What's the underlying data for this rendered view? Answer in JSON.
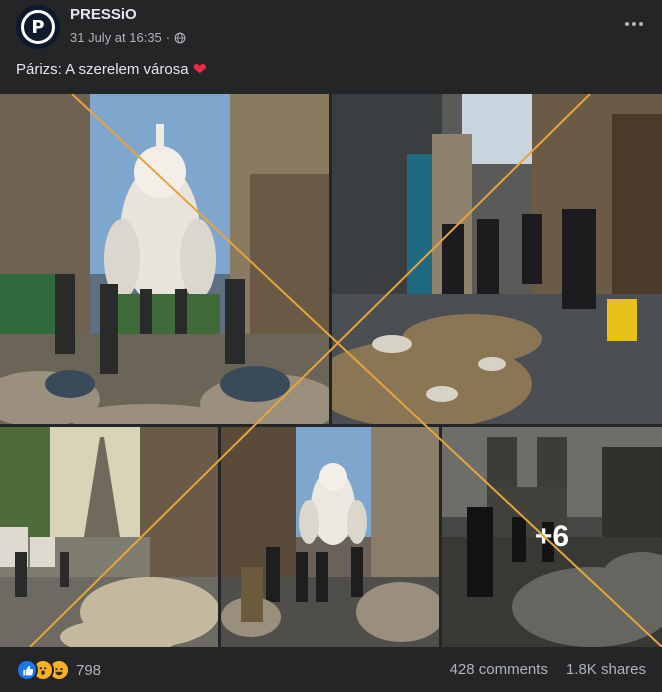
{
  "post": {
    "page_name": "PRESSiO",
    "avatar_letter": "P",
    "timestamp": "31 July at 16:35",
    "separator": "·",
    "caption": "Párizs: A szerelem városa",
    "caption_emoji": "❤"
  },
  "gallery": {
    "more_count": "+6",
    "cross_color": "#e8a33a"
  },
  "footer": {
    "reaction_count": "798",
    "comments": "428 comments",
    "shares": "1.8K shares"
  },
  "colors": {
    "background": "#242526",
    "text_primary": "#e4e6eb",
    "text_secondary": "#b0b3b8",
    "like_blue": "#1877f2",
    "heart_red": "#f02849"
  }
}
